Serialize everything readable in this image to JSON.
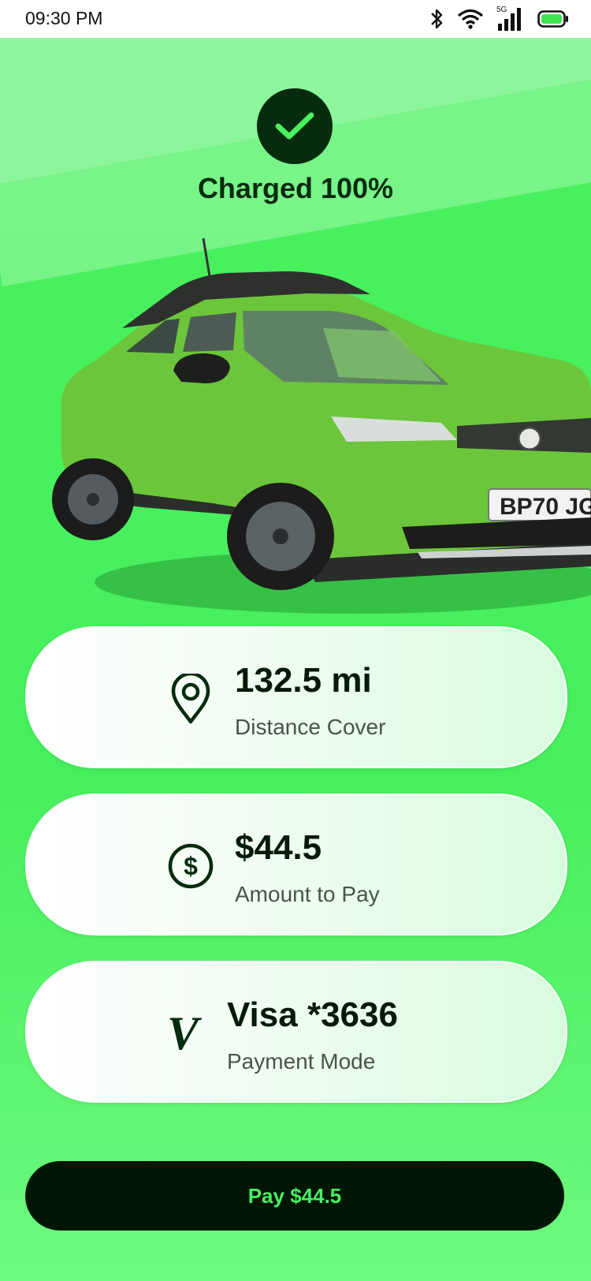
{
  "status_bar": {
    "time": "09:30 PM",
    "network_label": "5G",
    "icons": [
      "bluetooth-icon",
      "wifi-icon",
      "signal-icon",
      "battery-icon"
    ]
  },
  "header": {
    "status_icon": "check-icon",
    "title": "Charged 100%"
  },
  "vehicle": {
    "plate": "BP70 JG",
    "color": "#6cc63b"
  },
  "cards": [
    {
      "icon": "location-pin-icon",
      "value": "132.5 mi",
      "label": "Distance Cover"
    },
    {
      "icon": "dollar-icon",
      "value": "$44.5",
      "label": "Amount to Pay"
    },
    {
      "icon": "visa-icon",
      "icon_glyph": "V",
      "value": "Visa *3636",
      "label": "Payment Mode"
    }
  ],
  "pay_button": {
    "label": "Pay $44.5"
  },
  "colors": {
    "accent": "#49f05f",
    "dark": "#062b0d",
    "button_bg": "#021606"
  }
}
